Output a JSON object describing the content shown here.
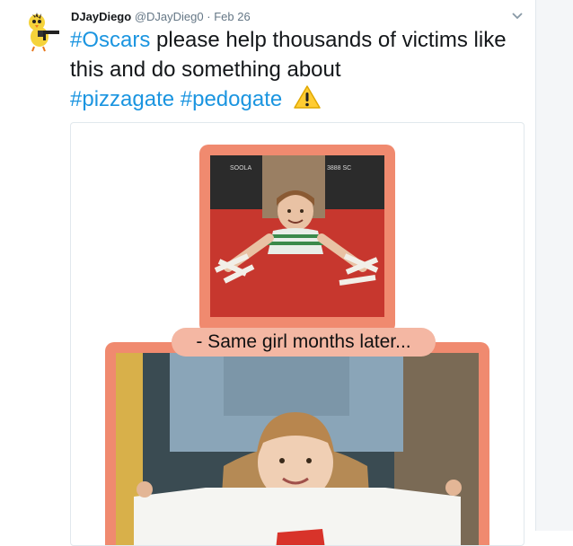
{
  "tweet": {
    "display_name": "DJayDiego",
    "handle": "@DJayDieg0",
    "separator": "·",
    "date": "Feb 26",
    "caret_icon": "chevron-down-icon",
    "hashtag_oscars": "#Oscars",
    "body_text": " please help thousands of victims like this and do something about ",
    "hashtag_pizzagate": "#pizzagate",
    "hashtag_pedogate": "#pedogate",
    "emoji_icon": "warning-icon"
  },
  "media": {
    "caption": "- Same girl months later...",
    "top_photo_sign_left": "SOOLA",
    "top_photo_sign_right": "3888 SC"
  },
  "colors": {
    "hashtag": "#1b95e0",
    "frame": "#f08a6f",
    "caption_bg": "#f4b7a3"
  }
}
